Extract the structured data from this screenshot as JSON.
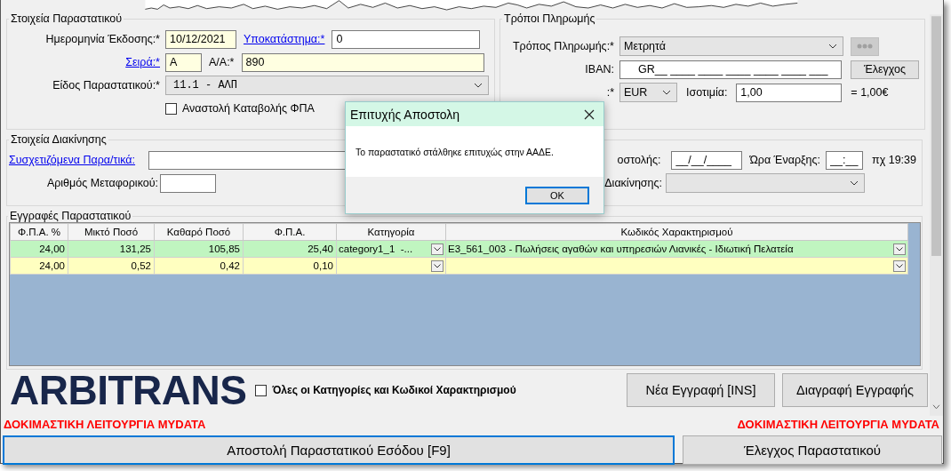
{
  "document": {
    "title": "Στοιχεία Παραστατικού",
    "issue_date": {
      "label": "Ημερομηνία Έκδοσης:*",
      "value": "10/12/2021"
    },
    "branch": {
      "label": "Υποκατάστημα:*",
      "value": "0"
    },
    "series": {
      "label": "Σειρά:*",
      "value": "Α"
    },
    "number": {
      "label": "Α/Α:*",
      "value": "890"
    },
    "type": {
      "label": "Είδος Παραστατικού:*",
      "value": "11.1 - ΑΛΠ"
    },
    "vat_suspension": {
      "label": "Αναστολή Καταβολής ΦΠΑ",
      "checked": false
    }
  },
  "payment": {
    "title": "Τρόποι Πληρωμής",
    "method": {
      "label": "Τρόπος Πληρωμής:*",
      "value": "Μετρητά"
    },
    "more_button": {
      "disabled": true
    },
    "iban": {
      "label": "IBAN:",
      "value": "GR__ ____ ____ ____ ____ ____ ___"
    },
    "check_button": {
      "label": "Έλεγχος",
      "disabled": false
    },
    "currency": {
      "label": ":*",
      "value": "EUR"
    },
    "rate": {
      "label": "Ισοτιμία:",
      "value": "1,00"
    },
    "rate_result": "= 1,00€"
  },
  "movement": {
    "title": "Στοιχεία Διακίνησης",
    "related": {
      "label": "Συσχετιζόμενα Παρα/τικά:"
    },
    "vehicle": {
      "label": "Αριθμός Μεταφορικού:"
    },
    "dispatch_date": {
      "label": "οστολής:",
      "value": "__/__/____"
    },
    "start_time": {
      "label": "Ώρα Έναρξης:",
      "value": "__:__"
    },
    "time_hint": "πχ 19:39",
    "purpose": {
      "label": "Διακίνησης:"
    }
  },
  "entries": {
    "title": "Εγγραφές Παραστατικού",
    "columns": [
      "Φ.Π.Α. %",
      "Μικτό Ποσό",
      "Καθαρό Ποσό",
      "Φ.Π.Α.",
      "Κατηγορία",
      "Κωδικός Χαρακτηρισμού"
    ],
    "rows": [
      {
        "color": "#c0f5c0",
        "vat_pct": "24,00",
        "gross": "131,25",
        "net": "105,85",
        "vat": "25,40",
        "category": "category1_1  -...",
        "code": "E3_561_003 - Πωλήσεις αγαθών και υπηρεσιών Λιανικές - Ιδιωτική Πελατεία"
      },
      {
        "color": "#ffffc0",
        "vat_pct": "24,00",
        "gross": "0,52",
        "net": "0,42",
        "vat": "0,10"
      }
    ]
  },
  "logo": "ARBITRANS",
  "show_all": {
    "label": "Όλες οι Κατηγορίες και Κωδικοί Χαρακτηρισμού",
    "checked": false
  },
  "entry_buttons": [
    "Νέα Εγγραφή [INS]",
    "Διαγραφή Εγγραφής"
  ],
  "test_mode_notices": [
    "ΔΟΚΙΜΑΣΤΙΚΗ ΛΕΙΤΟΥΡΓΙΑ MYDATA",
    "ΔΟΚΙΜΑΣΤΙΚΗ ΛΕΙΤΟΥΡΓΙΑ MYDATA"
  ],
  "actions": [
    {
      "label": "Αποστολή Παραστατικού Εσόδου [F9]",
      "focused": true
    },
    {
      "label": "Έλεγχος Παραστατικού",
      "focused": false
    }
  ],
  "dialog": {
    "title": "Επιτυχής Αποστολη",
    "message": "Το παραστατικό στάλθηκε επιτυχώς στην ΑΑΔΕ.",
    "ok": "OK"
  }
}
